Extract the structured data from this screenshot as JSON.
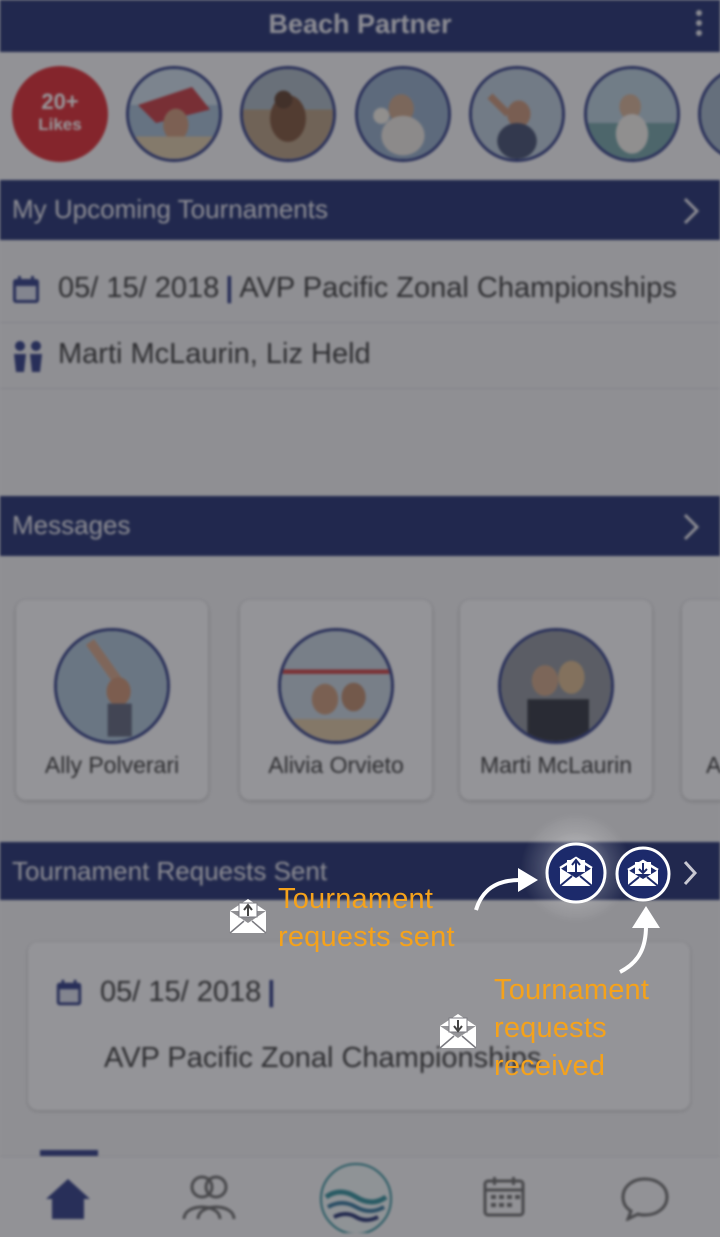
{
  "app": {
    "title": "Beach Partner"
  },
  "likes": {
    "count": "20+",
    "label": "Likes"
  },
  "sections": {
    "upcoming": "My Upcoming Tournaments",
    "messages": "Messages",
    "requests_sent": "Tournament Requests Sent"
  },
  "upcoming": {
    "date": "05/ 15/ 2018",
    "separator": "|",
    "event": "AVP Pacific Zonal Championships",
    "partners": "Marti McLaurin, Liz Held"
  },
  "messages": {
    "contacts": [
      {
        "name": "Ally Polverari"
      },
      {
        "name": "Alivia Orvieto"
      },
      {
        "name": "Marti McLaurin"
      },
      {
        "name": "A"
      }
    ]
  },
  "request_card": {
    "date": "05/ 15/ 2018",
    "separator": "|",
    "event": "AVP Pacific Zonal Championships"
  },
  "tabs": [
    {
      "icon": "home-icon",
      "active": true
    },
    {
      "icon": "people-icon"
    },
    {
      "icon": "beach-partner-logo"
    },
    {
      "icon": "calendar-icon"
    },
    {
      "icon": "chat-icon"
    }
  ],
  "annotations": {
    "sent_line1": "Tournament",
    "sent_line2": "requests sent",
    "recv_line1": "Tournament",
    "recv_line2": "requests",
    "recv_line3": "received"
  },
  "colors": {
    "primary": "#1c2a6b",
    "annotation": "#f5a21b",
    "likes_badge": "#d9242b",
    "overlay": "rgba(40,40,46,0.48)"
  }
}
